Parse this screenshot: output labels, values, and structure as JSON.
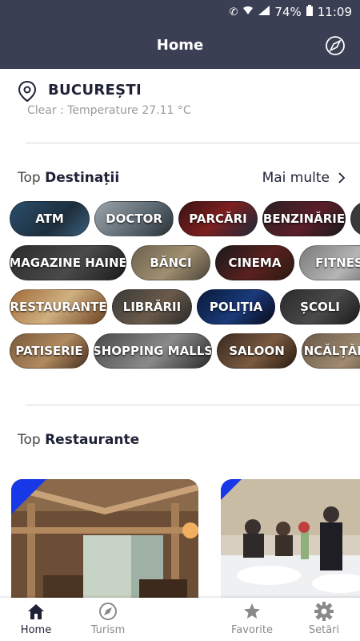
{
  "status_bar": {
    "battery": "74%",
    "time": "11:09"
  },
  "header": {
    "title": "Home"
  },
  "location": {
    "city": "BUCUREȘTI",
    "weather": "Clear : Temperature 27.11 °C"
  },
  "destinations": {
    "title_prefix": "Top",
    "title_main": "Destinații",
    "more_label": "Mai multe",
    "rows": [
      [
        "ATM",
        "DOCTOR",
        "PARCĂRI",
        "BENZINĂRIE"
      ],
      [
        "MAGAZINE HAINE",
        "BĂNCI",
        "CINEMA",
        "FITNESS"
      ],
      [
        "RESTAURANTE",
        "LIBRĂRII",
        "POLIȚIA",
        "ȘCOLI"
      ],
      [
        "PATISERIE",
        "SHOPPING MALLS",
        "SALOON",
        "ÎNCĂLȚĂMINTE"
      ]
    ]
  },
  "restaurants": {
    "title_prefix": "Top",
    "title_main": "Restaurante"
  },
  "accent_color": "#1638e6",
  "header_color": "#3b3f54",
  "bottom_nav": {
    "items": [
      {
        "label": "Home",
        "icon": "home-icon"
      },
      {
        "label": "Turism",
        "icon": "compass-icon"
      },
      {
        "label": "Favorite",
        "icon": "star-icon"
      },
      {
        "label": "Setări",
        "icon": "gear-icon"
      }
    ]
  }
}
